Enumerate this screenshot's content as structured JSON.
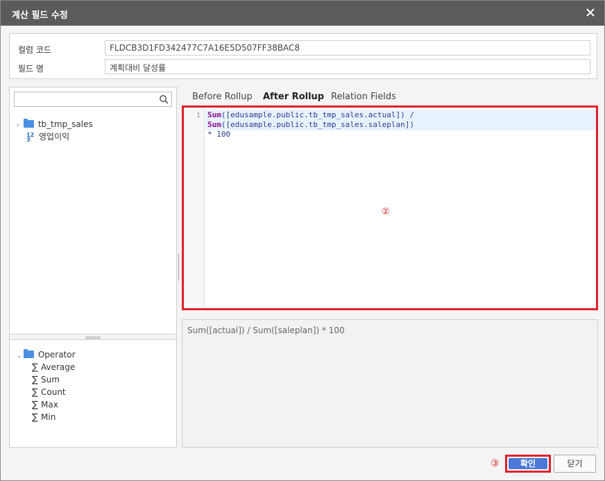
{
  "dialog": {
    "title": "계산 필드 수정",
    "close_icon": "close-icon"
  },
  "fields": {
    "column_code_label": "컬럼 코드",
    "column_code_value": "FLDCB3D1FD342477C7A16E5D507FF38BAC8",
    "field_name_label": "필드 명",
    "field_name_value": "계획대비 달성률"
  },
  "left_pane": {
    "search_placeholder": "",
    "search_icon": "search-icon",
    "tree": [
      {
        "label": "tb_tmp_sales",
        "icon": "folder-icon"
      },
      {
        "label": "영업이익",
        "icon": "number-field-icon"
      }
    ],
    "operators": {
      "label": "Operator",
      "icon": "folder-icon",
      "items": [
        "Average",
        "Sum",
        "Count",
        "Max",
        "Min"
      ]
    }
  },
  "tabs": [
    "Before Rollup",
    "After Rollup",
    "Relation Fields"
  ],
  "active_tab": "After Rollup",
  "editor": {
    "line_number": "1",
    "code_fn1": "Sum",
    "code_part1": "([edusample.public.tb_tmp_sales.actual]) / ",
    "code_fn2": "Sum",
    "code_part2": "([edusample.public.tb_tmp_sales.saleplan])",
    "code_line2": "* 100",
    "marker": "②"
  },
  "preview": {
    "text": "Sum([actual]) / Sum([saleplan]) * 100"
  },
  "footer": {
    "marker": "③",
    "ok_label": "확인",
    "close_label": "닫기"
  },
  "colors": {
    "titlebar": "#5b5b5b",
    "highlight_border": "#e0202a",
    "ok_button": "#4b79d8",
    "folder": "#4a8fe0"
  }
}
